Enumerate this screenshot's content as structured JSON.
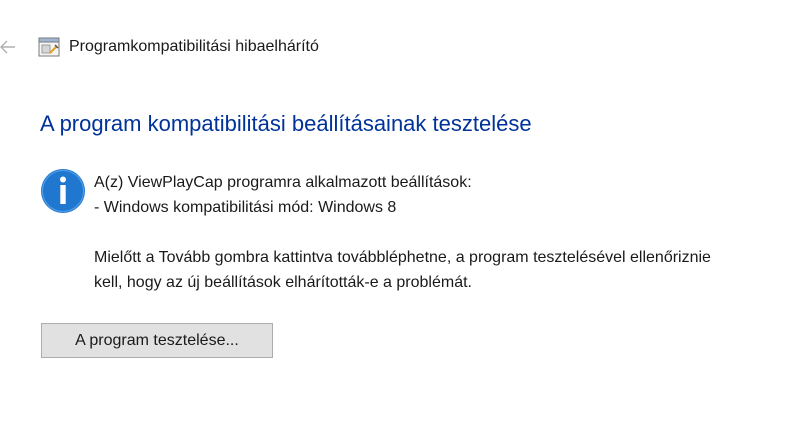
{
  "window": {
    "title": "Programkompatibilitási hibaelhárító"
  },
  "main": {
    "heading": "A program kompatibilitási beállításainak tesztelése",
    "info": {
      "line1": "A(z) ViewPlayCap programra alkalmazott beállítások:",
      "line2": "- Windows kompatibilitási mód: Windows 8",
      "paragraph_line1": "Mielőtt a Tovább gombra kattintva továbbléphetne, a program tesztelésével ellenőriznie",
      "paragraph_line2": "kell, hogy az új beállítások elhárították-e a problémát."
    },
    "test_button_label": "A program tesztelése..."
  },
  "icons": {
    "back": "back-arrow-icon",
    "app": "troubleshooter-icon",
    "info": "info-icon"
  },
  "colors": {
    "heading": "#003399",
    "info_icon": "#1f77d0",
    "button_bg": "#e1e1e1",
    "button_border": "#adadad"
  }
}
